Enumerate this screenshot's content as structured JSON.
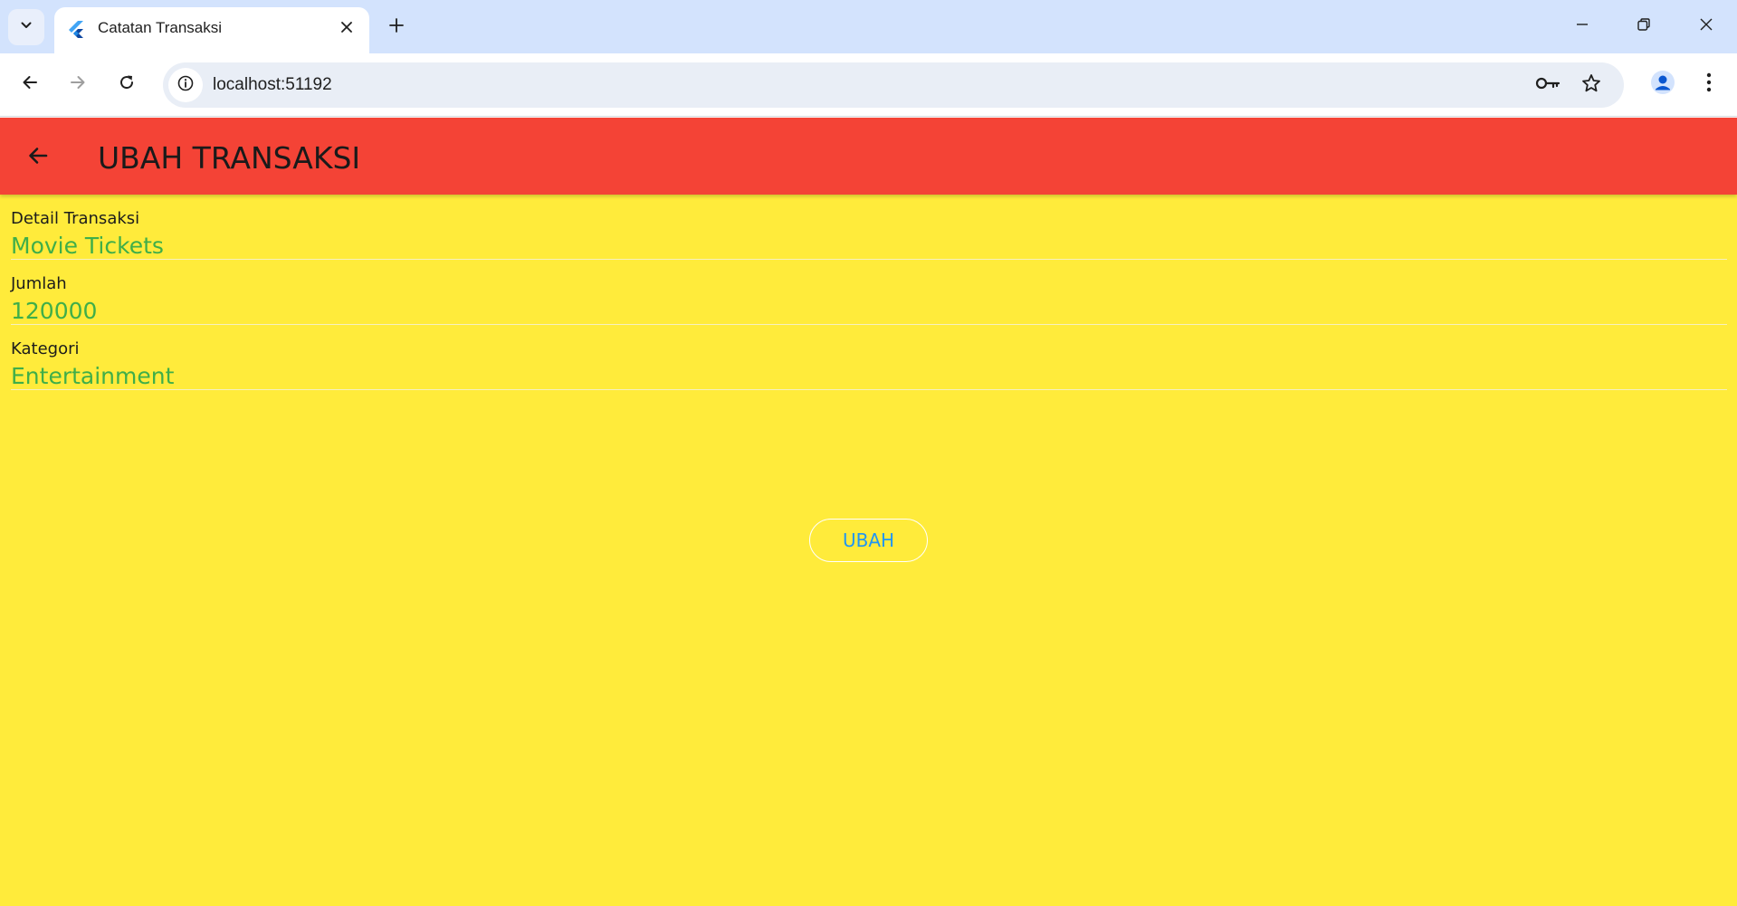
{
  "browser": {
    "tab_title": "Catatan Transaksi",
    "url": "localhost:51192",
    "icons": {
      "tab_search": "chevron-down-icon",
      "favicon": "flutter-icon",
      "tab_close": "close-icon",
      "new_tab": "plus-icon",
      "minimize": "minimize-icon",
      "restore": "restore-icon",
      "close_window": "close-icon",
      "back": "arrow-left-icon",
      "forward": "arrow-right-icon",
      "reload": "reload-icon",
      "site_info": "info-icon",
      "password": "key-icon",
      "bookmark": "star-icon",
      "profile": "person-icon",
      "menu": "kebab-menu-icon"
    }
  },
  "app": {
    "title": "UBAH TRANSAKSI",
    "colors": {
      "appbar": "#f44336",
      "background": "#ffeb3b",
      "value_text": "#3fae49",
      "button_text": "#2196f3"
    },
    "fields": [
      {
        "label": "Detail Transaksi",
        "value": "Movie Tickets"
      },
      {
        "label": "Jumlah",
        "value": "120000"
      },
      {
        "label": "Kategori",
        "value": "Entertainment"
      }
    ],
    "submit_label": "UBAH"
  }
}
